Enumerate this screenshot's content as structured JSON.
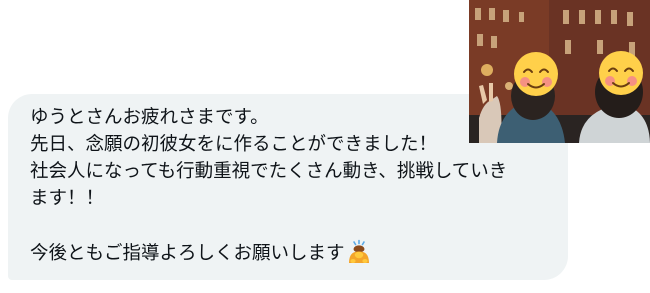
{
  "message": {
    "lines": [
      "ゆうとさんお疲れさまです。",
      "先日、念願の初彼女をに作ることができました！",
      "社会人になっても行動重視でたくさん動き、挑戦していき",
      "ます！！",
      "",
      "今後ともご指導よろしくお願いします"
    ],
    "trailing_emoji": "person-bowing-emoji"
  },
  "photo": {
    "subject": "couple-selfie-at-night",
    "face_covers": [
      "smiling-face-sticker",
      "smiling-face-sticker"
    ]
  },
  "colors": {
    "bubble_background": "#eff3f4",
    "text": "#0f1419",
    "sticker_face": "#ffd04a",
    "sticker_blush": "#f48a8a"
  }
}
